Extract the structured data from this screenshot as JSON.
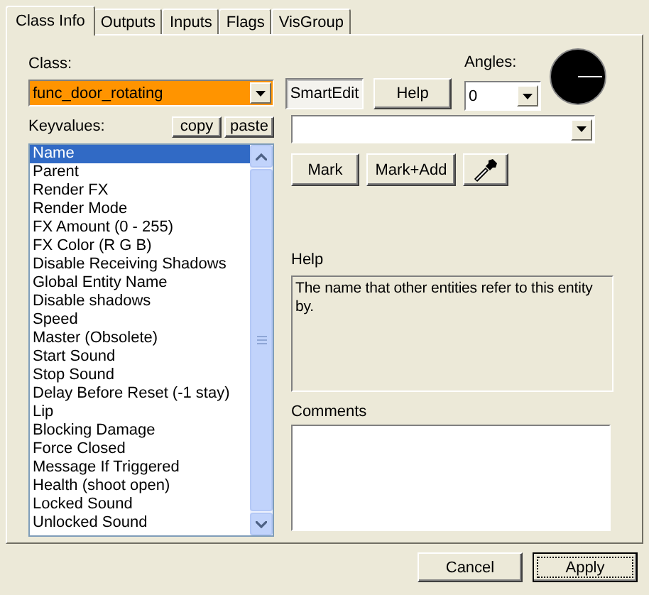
{
  "tabs": [
    {
      "label": "Class Info",
      "selected": true
    },
    {
      "label": "Outputs",
      "selected": false
    },
    {
      "label": "Inputs",
      "selected": false
    },
    {
      "label": "Flags",
      "selected": false
    },
    {
      "label": "VisGroup",
      "selected": false
    }
  ],
  "class_label": "Class:",
  "class_value": "func_door_rotating",
  "smartedit": {
    "label": "SmartEdit",
    "pressed": true
  },
  "help_button": "Help",
  "angles": {
    "label": "Angles:",
    "value": "0"
  },
  "keyvalues_label": "Keyvalues:",
  "copy_button": "copy",
  "paste_button": "paste",
  "keyvalues": [
    {
      "label": "Name",
      "selected": true
    },
    {
      "label": "Parent",
      "selected": false
    },
    {
      "label": "Render FX",
      "selected": false
    },
    {
      "label": "Render Mode",
      "selected": false
    },
    {
      "label": "FX Amount (0 - 255)",
      "selected": false
    },
    {
      "label": "FX Color (R G B)",
      "selected": false
    },
    {
      "label": "Disable Receiving Shadows",
      "selected": false
    },
    {
      "label": "Global Entity Name",
      "selected": false
    },
    {
      "label": "Disable shadows",
      "selected": false
    },
    {
      "label": "Speed",
      "selected": false
    },
    {
      "label": "Master (Obsolete)",
      "selected": false
    },
    {
      "label": "Start Sound",
      "selected": false
    },
    {
      "label": "Stop Sound",
      "selected": false
    },
    {
      "label": "Delay Before Reset (-1 stay)",
      "selected": false
    },
    {
      "label": "Lip",
      "selected": false
    },
    {
      "label": "Blocking Damage",
      "selected": false
    },
    {
      "label": "Force Closed",
      "selected": false
    },
    {
      "label": "Message If Triggered",
      "selected": false
    },
    {
      "label": "Health (shoot open)",
      "selected": false
    },
    {
      "label": "Locked Sound",
      "selected": false
    },
    {
      "label": "Unlocked Sound",
      "selected": false
    }
  ],
  "mark_button": "Mark",
  "mark_add_button": "Mark+Add",
  "help_label": "Help",
  "help_text": "The name that other entities refer to this entity by.",
  "comments_label": "Comments",
  "buttons": [
    {
      "label": "Cancel",
      "default": false
    },
    {
      "label": "Apply",
      "default": true
    }
  ]
}
